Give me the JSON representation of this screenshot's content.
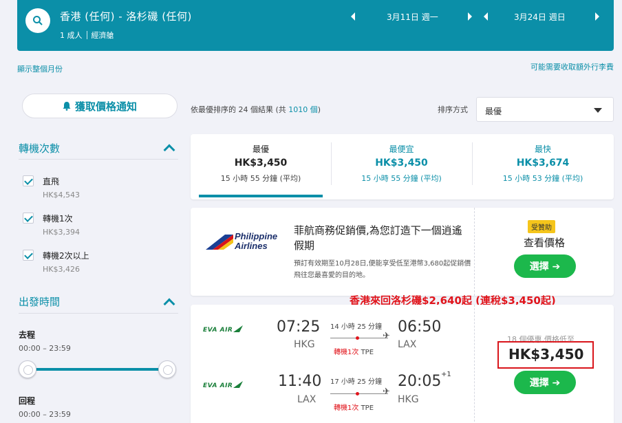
{
  "search": {
    "route": "香港 (任何) - 洛杉磯 (任何)",
    "passengers": "1 成人",
    "cabin": "經濟艙",
    "depart_date": "3月11日 週一",
    "return_date": "3月24日 週日"
  },
  "links": {
    "show_month": "顯示整個月份",
    "extra_fees": "可能需要收取額外行李費"
  },
  "sidebar": {
    "price_alert": "獲取價格通知",
    "stops_title": "轉機次數",
    "stops": [
      {
        "label": "直飛",
        "price": "HK$4,543"
      },
      {
        "label": "轉機1次",
        "price": "HK$3,394"
      },
      {
        "label": "轉機2次以上",
        "price": "HK$3,426"
      }
    ],
    "depart_title": "出發時間",
    "outbound_label": "去程",
    "outbound_range": "00:00 – 23:59",
    "return_label": "回程",
    "return_range": "00:00 – 23:59"
  },
  "results": {
    "count_prefix": "依最優排序的 24 個結果 (共 ",
    "count_total": "1010 個",
    "count_suffix": ")",
    "sort_label": "排序方式",
    "sort_value": "最優"
  },
  "tabs": [
    {
      "label": "最優",
      "price": "HK$3,450",
      "duration": "15 小時 55 分鐘 (平均)"
    },
    {
      "label": "最便宜",
      "price": "HK$3,450",
      "duration": "15 小時 55 分鐘 (平均)"
    },
    {
      "label": "最快",
      "price": "HK$3,674",
      "duration": "15 小時 53 分鐘 (平均)"
    }
  ],
  "promo": {
    "airline_line1": "Philippine",
    "airline_line2": "Airlines",
    "title": "菲航商務促銷價,為您訂造下一個逍遙假期",
    "desc": "預訂有效期至10月28日,便能享受低至港幣3,680起促銷價飛往您最喜愛的目的地。",
    "badge": "受贊助",
    "view_price": "查看價格",
    "select": "選擇 ➔"
  },
  "annotation": "香港來回洛杉磯$2,640起 (連稅$3,450起)",
  "flight": {
    "airline": "EVA AIR",
    "outbound": {
      "dep_time": "07:25",
      "dep_code": "HKG",
      "arr_time": "06:50",
      "arr_code": "LAX",
      "duration": "14 小時 25 分鐘",
      "stops": "轉機1次",
      "via": "TPE"
    },
    "inbound": {
      "dep_time": "11:40",
      "dep_code": "LAX",
      "arr_time": "20:05",
      "arr_code": "HKG",
      "plus_day": "+1",
      "duration": "17 小時 25 分鐘",
      "stops": "轉機1次",
      "via": "TPE"
    },
    "deals": "18 個優惠,價格低至",
    "price": "HK$3,450",
    "select": "選擇 ➔"
  },
  "colors": {
    "brand": "#0b8fa8",
    "cta": "#1cb84c",
    "highlight": "#e1141b",
    "badge": "#f5c51b"
  }
}
